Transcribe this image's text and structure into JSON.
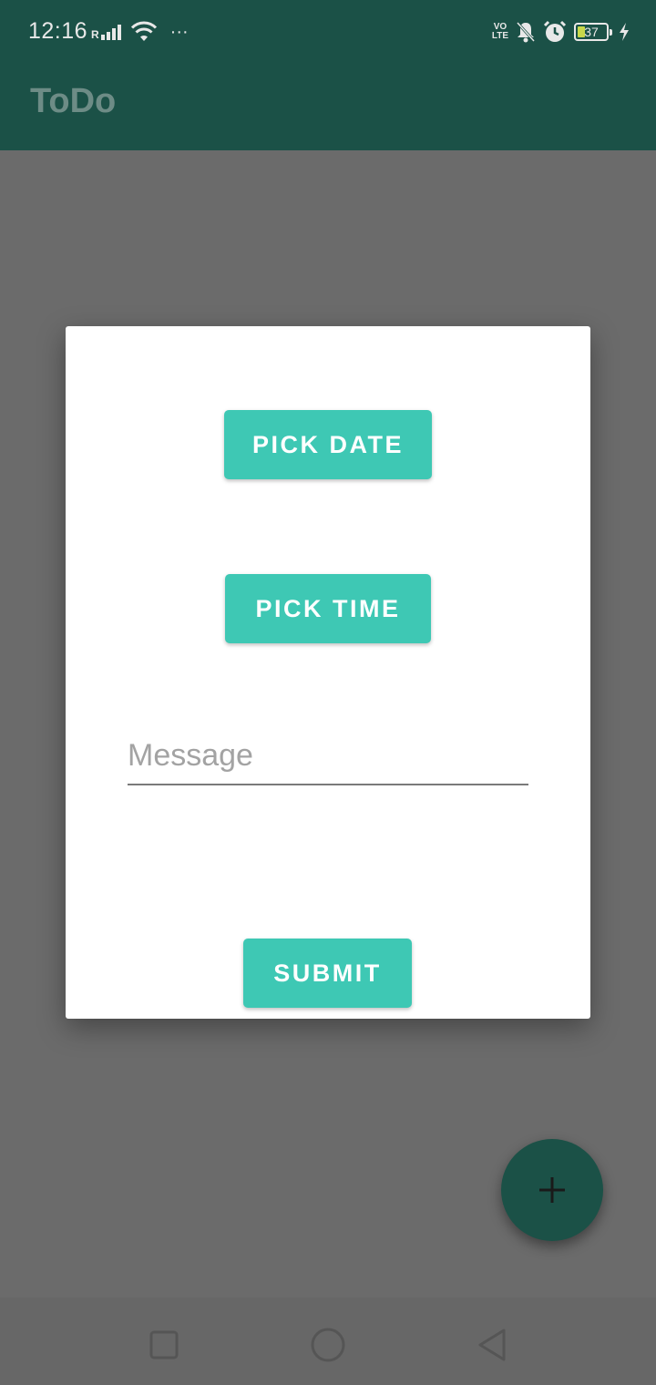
{
  "status_bar": {
    "time": "12:16",
    "roaming_label": "R",
    "more_label": "···",
    "volte_top": "VO",
    "volte_bottom": "LTE",
    "battery_level": "37"
  },
  "app_bar": {
    "title": "ToDo"
  },
  "dialog": {
    "pick_date_label": "PICK DATE",
    "pick_time_label": "PICK TIME",
    "message_placeholder": "Message",
    "message_value": "",
    "submit_label": "SUBMIT"
  },
  "fab": {
    "icon": "plus-icon"
  },
  "nav_bar": {
    "icons": [
      "recents-icon",
      "home-icon",
      "back-icon"
    ]
  },
  "colors": {
    "primary_dark": "#1b5147",
    "accent": "#3ec8b4",
    "scrim": "#6b6b6b"
  }
}
